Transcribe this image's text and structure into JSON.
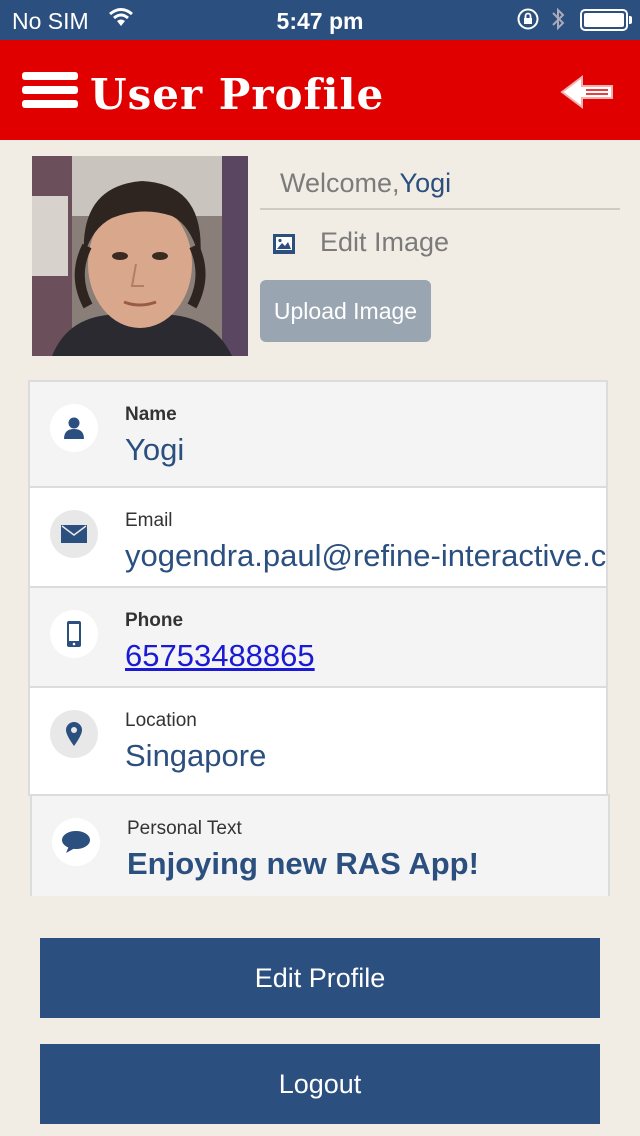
{
  "status_bar": {
    "carrier": "No SIM",
    "time": "5:47 pm"
  },
  "header": {
    "title": "User Profile"
  },
  "profile": {
    "welcome_prefix": "Welcome,",
    "welcome_name": "Yogi",
    "edit_image_label": "Edit Image",
    "upload_image_label": "Upload Image"
  },
  "fields": [
    {
      "label": "Name",
      "value": "Yogi",
      "icon": "user-icon"
    },
    {
      "label": "Email",
      "value": "yogendra.paul@refine-interactive.c",
      "icon": "envelope-icon"
    },
    {
      "label": "Phone",
      "value": "65753488865",
      "icon": "mobile-phone-icon"
    },
    {
      "label": "Location",
      "value": "Singapore",
      "icon": "map-pin-icon"
    },
    {
      "label": "Personal Text",
      "value": "Enjoying new RAS App!",
      "icon": "speech-bubble-icon"
    }
  ],
  "buttons": {
    "edit_profile": "Edit Profile",
    "logout": "Logout"
  },
  "colors": {
    "status_bar": "#2b4f7e",
    "header": "#e00000",
    "accent": "#2b4f7e",
    "background": "#f2ede4",
    "link": "#1a1ad4"
  }
}
